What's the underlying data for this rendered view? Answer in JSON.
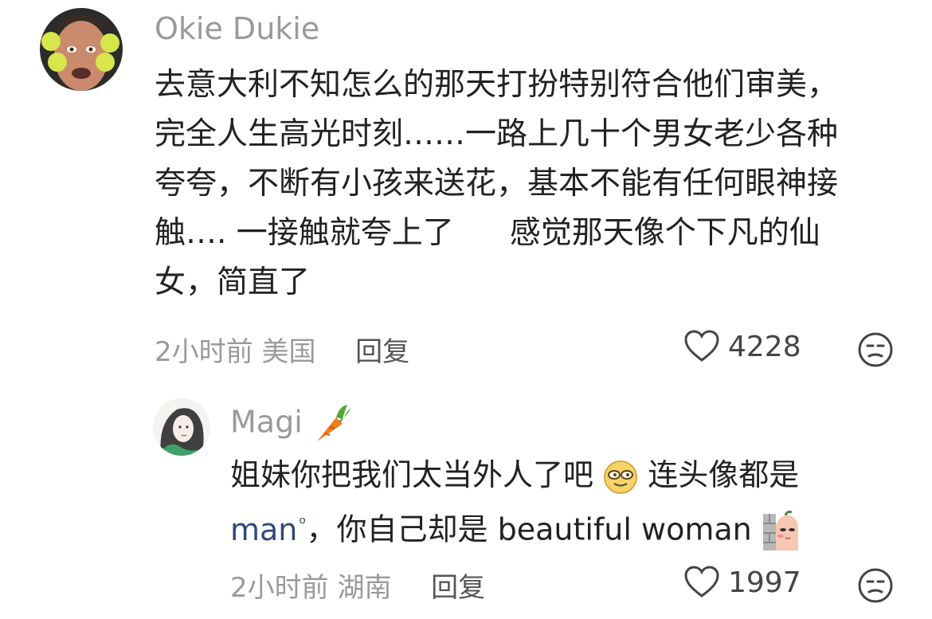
{
  "comment": {
    "username": "Okie Dukie",
    "avatar_icon": "man-holding-tennis-balls-avatar",
    "lines": [
      "去意大利不知怎么的那天打扮特别符合他们审美，",
      "完全人生高光时刻……一路上几十个男女老少各种",
      "夸夸，不断有小孩来送花，基本不能有任何眼神接",
      "触…. 一接触就夸上了",
      "感觉那天像个下凡的仙",
      "女，简直了"
    ],
    "time": "2小时前",
    "location": "美国",
    "reply_label": "回复",
    "like_count": "4228"
  },
  "reply": {
    "username": "Magi",
    "avatar_icon": "girl-with-green-hair-avatar",
    "badge_icon": "carrot-icon",
    "line1_prefix": "姐妹你把我们太当外人了吧",
    "line1_suffix": "连头像都是",
    "mention": "man",
    "line2_suffix": "，你自己却是 beautiful woman",
    "time": "2小时前",
    "location": "湖南",
    "reply_label": "回复",
    "like_count": "1997"
  },
  "colors": {
    "text_primary": "#222222",
    "text_secondary": "#9a9a9a",
    "mention": "#31497a"
  }
}
